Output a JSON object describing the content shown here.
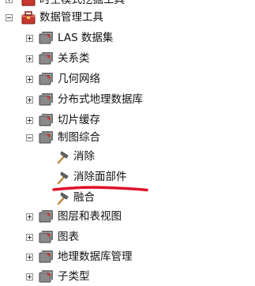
{
  "tree": {
    "partial_top_item": "时空模式挖掘工具",
    "root": {
      "label": "数据管理工具",
      "expanded": true
    },
    "children": [
      {
        "label": "LAS 数据集",
        "expanded": false
      },
      {
        "label": "关系类",
        "expanded": false
      },
      {
        "label": "几何网络",
        "expanded": false
      },
      {
        "label": "分布式地理数据库",
        "expanded": false
      },
      {
        "label": "切片缓存",
        "expanded": false
      },
      {
        "label": "制图综合",
        "expanded": true
      },
      {
        "label": "图层和表视图",
        "expanded": false
      },
      {
        "label": "图表",
        "expanded": false
      },
      {
        "label": "地理数据库管理",
        "expanded": false
      },
      {
        "label": "子类型",
        "expanded": false
      }
    ],
    "tools": [
      {
        "label": "消除"
      },
      {
        "label": "消除面部件",
        "highlighted": true
      },
      {
        "label": "融合"
      }
    ]
  },
  "colors": {
    "highlight_underline": "#e0102a",
    "toolbox_red": "#c8372d",
    "toolset_gray": "#6e6e6e",
    "hammer_head": "#6b6b6b",
    "hammer_handle": "#b8863b"
  },
  "icons": {
    "toolbox": "toolbox-icon",
    "toolset": "toolset-icon",
    "tool": "hammer-icon"
  }
}
